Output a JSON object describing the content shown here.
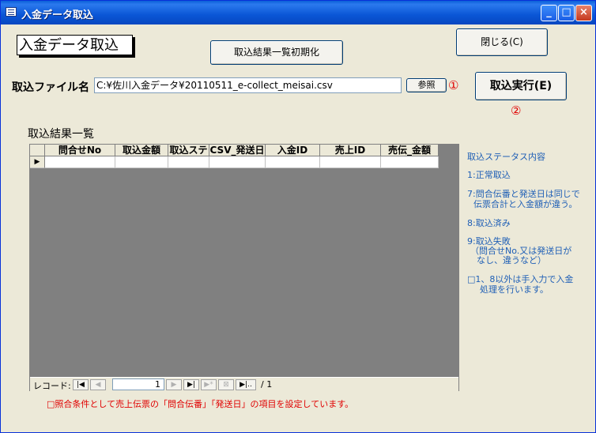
{
  "window": {
    "title": "入金データ取込",
    "minimize": "_",
    "maximize": "□",
    "close": "×"
  },
  "form": {
    "heading": "入金データ取込",
    "reset_button": "取込結果一覧初期化",
    "close_button": "閉じる(C)",
    "file_label": "取込ファイル名",
    "file_path": "C:¥佐川入金データ¥20110511_e-collect_meisai.csv",
    "browse_button": "参照",
    "browse_marker": "①",
    "run_button": "取込実行(E)",
    "run_marker": "②",
    "results_label": "取込結果一覧"
  },
  "grid": {
    "columns": [
      "問合せNo",
      "取込金額",
      "取込ステ",
      "CSV_発送日",
      "入金ID",
      "売上ID",
      "売伝_金額"
    ],
    "row_indicator": "▶"
  },
  "navigation": {
    "label": "レコード:",
    "first": "|◀",
    "prev": "◀",
    "current": "1",
    "next": "▶",
    "last": "▶|",
    "new": "▶*",
    "delete": "⊠",
    "last_alt": "▶|..",
    "total": "/ 1"
  },
  "legend": {
    "title": "取込ステータス内容",
    "s1": "1:正常取込",
    "s7_line1": "7:問合伝番と発送日は同じで",
    "s7_line2": "伝票合計と入金額が違う。",
    "s8": "8:取込済み",
    "s9_line1": "9:取込失敗",
    "s9_line2": "（問合せNo.又は発送日が",
    "s9_line3": "なし、違うなど）",
    "note_line1": "□1、8以外は手入力で入金",
    "note_line2": "処理を行います。"
  },
  "footer_note": "□照合条件として売上伝票の「問合伝番」「発送日」の項目を設定しています。"
}
